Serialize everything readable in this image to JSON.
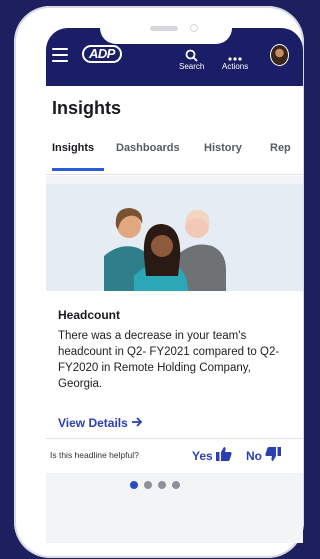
{
  "header": {
    "logo_text": "ADP",
    "search_label": "Search",
    "actions_label": "Actions"
  },
  "page": {
    "title": "Insights"
  },
  "tabs": [
    {
      "label": "Insights",
      "active": true
    },
    {
      "label": "Dashboards",
      "active": false
    },
    {
      "label": "History",
      "active": false
    },
    {
      "label": "Rep",
      "active": false
    }
  ],
  "card": {
    "title": "Headcount",
    "body": "There was a decrease in your team's headcount in Q2- FY2021 compared to Q2- FY2020 in Remote Holding Company, Georgia.",
    "link_label": "View Details",
    "link_icon": "arrow-right-icon"
  },
  "feedback": {
    "question": "Is this headline helpful?",
    "yes_label": "Yes",
    "no_label": "No"
  },
  "pagination": {
    "total": 4,
    "active": 1
  },
  "colors": {
    "background": "#1d1f5e",
    "appbar": "#1a1e66",
    "accent": "#2b3fb5",
    "tab_underline": "#2b5bd7"
  }
}
